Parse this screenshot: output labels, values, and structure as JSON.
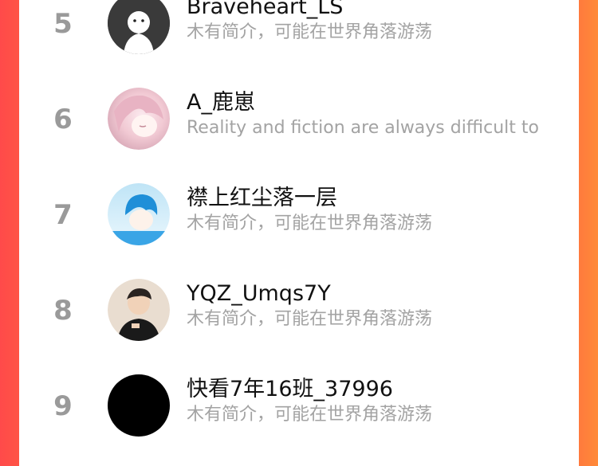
{
  "colors": {
    "left_edge": "#ff4a4a",
    "right_edge": "#ff8a38",
    "rank_gray": "#9a9a9a",
    "bio_gray": "#a3a3a3",
    "name_black": "#111111"
  },
  "ranking": [
    {
      "rank": "5",
      "name": "Braveheart_LS",
      "bio": "木有简介，可能在世界角落游荡",
      "avatar": "ghost-avatar"
    },
    {
      "rank": "6",
      "name": "A_鹿崽",
      "bio": "Reality and fiction are always difficult to",
      "avatar": "anime-girl-avatar"
    },
    {
      "rank": "7",
      "name": "襟上红尘落一层",
      "bio": "木有简介，可能在世界角落游荡",
      "avatar": "blue-hair-anime-avatar"
    },
    {
      "rank": "8",
      "name": "YQZ_Umqs7Y",
      "bio": "木有简介，可能在世界角落游荡",
      "avatar": "boy-photo-avatar"
    },
    {
      "rank": "9",
      "name": "快看7年16班_37996",
      "bio": "木有简介，可能在世界角落游荡",
      "avatar": "black-avatar"
    }
  ]
}
